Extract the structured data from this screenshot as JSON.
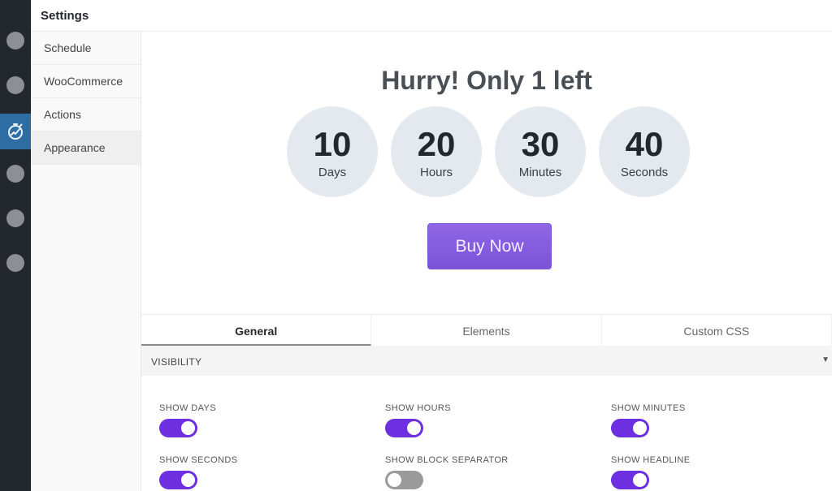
{
  "header": {
    "title": "Settings"
  },
  "rail": {
    "items": [
      {
        "icon": "menu-dot-icon",
        "active": false
      },
      {
        "icon": "menu-dot-icon",
        "active": false
      },
      {
        "icon": "timer-chart-icon",
        "active": true
      },
      {
        "icon": "menu-dot-icon",
        "active": false
      },
      {
        "icon": "menu-dot-icon",
        "active": false
      },
      {
        "icon": "menu-dot-icon",
        "active": false
      }
    ]
  },
  "submenu": {
    "items": [
      {
        "label": "Schedule",
        "active": false
      },
      {
        "label": "WooCommerce",
        "active": false
      },
      {
        "label": "Actions",
        "active": false
      },
      {
        "label": "Appearance",
        "active": true
      }
    ]
  },
  "preview": {
    "headline": "Hurry! Only 1 left",
    "countdown": [
      {
        "value": "10",
        "label": "Days"
      },
      {
        "value": "20",
        "label": "Hours"
      },
      {
        "value": "30",
        "label": "Minutes"
      },
      {
        "value": "40",
        "label": "Seconds"
      }
    ],
    "button_label": "Buy Now",
    "accent_color": "#7c52d9"
  },
  "tabs": [
    {
      "label": "General",
      "active": true
    },
    {
      "label": "Elements",
      "active": false
    },
    {
      "label": "Custom CSS",
      "active": false
    }
  ],
  "visibility": {
    "title": "VISIBILITY",
    "arrow": "▼",
    "toggle_on_color": "#6d2fe0",
    "toggle_off_color": "#9a9a9a",
    "settings": [
      {
        "label": "SHOW DAYS",
        "on": true
      },
      {
        "label": "SHOW HOURS",
        "on": true
      },
      {
        "label": "SHOW MINUTES",
        "on": true
      },
      {
        "label": "SHOW SECONDS",
        "on": true
      },
      {
        "label": "SHOW BLOCK SEPARATOR",
        "on": false
      },
      {
        "label": "SHOW HEADLINE",
        "on": true
      }
    ]
  }
}
